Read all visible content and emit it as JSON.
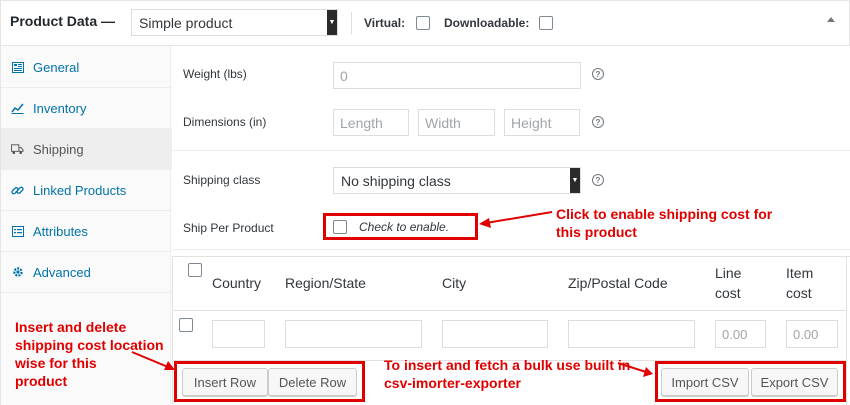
{
  "header": {
    "title": "Product Data —",
    "product_type": "Simple product",
    "virtual_label": "Virtual:",
    "downloadable_label": "Downloadable:"
  },
  "sidebar": {
    "items": [
      {
        "label": "General",
        "icon": "general-icon"
      },
      {
        "label": "Inventory",
        "icon": "inventory-icon"
      },
      {
        "label": "Shipping",
        "icon": "truck-icon",
        "active": true
      },
      {
        "label": "Linked Products",
        "icon": "link-icon"
      },
      {
        "label": "Attributes",
        "icon": "list-icon"
      },
      {
        "label": "Advanced",
        "icon": "gear-icon"
      }
    ]
  },
  "shipping": {
    "weight_label": "Weight (lbs)",
    "weight_placeholder": "0",
    "dimensions_label": "Dimensions (in)",
    "length_placeholder": "Length",
    "width_placeholder": "Width",
    "height_placeholder": "Height",
    "class_label": "Shipping class",
    "class_value": "No shipping class",
    "per_product_label": "Ship Per Product",
    "per_product_hint": "Check to enable."
  },
  "table": {
    "headers": {
      "country": "Country",
      "region": "Region/State",
      "city": "City",
      "zip": "Zip/Postal Code",
      "line_cost_1": "Line",
      "line_cost_2": "cost",
      "item_cost_1": "Item",
      "item_cost_2": "cost"
    },
    "row": {
      "line_cost_placeholder": "0.00",
      "item_cost_placeholder": "0.00"
    },
    "buttons": {
      "insert": "Insert Row",
      "delete": "Delete Row",
      "import": "Import CSV",
      "export": "Export CSV"
    }
  },
  "annotations": {
    "enable_line1": "Click to enable shipping cost for",
    "enable_line2": "this product",
    "rows_line1": "Insert and delete",
    "rows_line2": "shipping cost location",
    "rows_line3": "wise for this",
    "rows_line4": "product",
    "csv_line1": "To insert and fetch a bulk use built in",
    "csv_line2": "csv-imorter-exporter"
  },
  "colors": {
    "annotation_red": "#e00000",
    "link_blue": "#0073aa"
  }
}
